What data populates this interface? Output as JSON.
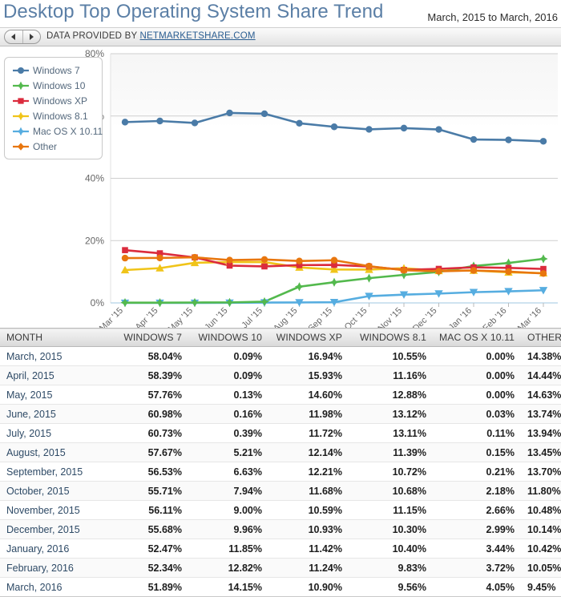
{
  "header": {
    "title": "Desktop Top Operating System Share Trend",
    "date_range": "March, 2015 to March, 2016"
  },
  "toolbar": {
    "prev_label": "◀",
    "next_label": "▶",
    "text_prefix": "DATA PROVIDED BY ",
    "link_label": "NETMARKETSHARE.COM"
  },
  "legend": {
    "items": [
      {
        "label": "Windows 7",
        "color": "#4a7ba7",
        "marker": "circle"
      },
      {
        "label": "Windows 10",
        "color": "#53b94d",
        "marker": "star4"
      },
      {
        "label": "Windows XP",
        "color": "#db2b3d",
        "marker": "square"
      },
      {
        "label": "Windows 8.1",
        "color": "#f0c419",
        "marker": "star5"
      },
      {
        "label": "Mac OS X 10.11",
        "color": "#56ade0",
        "marker": "star6"
      },
      {
        "label": "Other",
        "color": "#e8760e",
        "marker": "diamond"
      }
    ]
  },
  "chart_data": {
    "type": "line",
    "title": "Desktop Top Operating System Share Trend",
    "xlabel": "",
    "ylabel": "",
    "ylim": [
      0,
      80
    ],
    "yticks": [
      "0%",
      "20%",
      "40%",
      "60%",
      "80%"
    ],
    "ytick_values": [
      0,
      20,
      40,
      60,
      80
    ],
    "grid": true,
    "legend_position": "top-left",
    "categories": [
      "Mar '15",
      "Apr '15",
      "May '15",
      "Jun '15",
      "Jul '15",
      "Aug '15",
      "Sep '15",
      "Oct '15",
      "Nov '15",
      "Dec '15",
      "Jan '16",
      "Feb '16",
      "Mar '16"
    ],
    "series": [
      {
        "name": "Windows 7",
        "color": "#4a7ba7",
        "marker": "circle",
        "values": [
          58.04,
          58.39,
          57.76,
          60.98,
          60.73,
          57.67,
          56.53,
          55.71,
          56.11,
          55.68,
          52.47,
          52.34,
          51.89
        ]
      },
      {
        "name": "Windows 10",
        "color": "#53b94d",
        "marker": "star4",
        "values": [
          0.09,
          0.09,
          0.13,
          0.16,
          0.39,
          5.21,
          6.63,
          7.94,
          9.0,
          9.96,
          11.85,
          12.82,
          14.15
        ]
      },
      {
        "name": "Windows XP",
        "color": "#db2b3d",
        "marker": "square",
        "values": [
          16.94,
          15.93,
          14.6,
          11.98,
          11.72,
          12.14,
          12.21,
          11.68,
          10.59,
          10.93,
          11.42,
          11.24,
          10.9
        ]
      },
      {
        "name": "Windows 8.1",
        "color": "#f0c419",
        "marker": "triangle-up",
        "values": [
          10.55,
          11.16,
          12.88,
          13.12,
          13.11,
          11.39,
          10.72,
          10.68,
          11.15,
          10.3,
          10.4,
          9.83,
          9.56
        ]
      },
      {
        "name": "Mac OS X 10.11",
        "color": "#56ade0",
        "marker": "triangle-down",
        "values": [
          0.0,
          0.0,
          0.0,
          0.03,
          0.11,
          0.15,
          0.21,
          2.18,
          2.66,
          2.99,
          3.44,
          3.72,
          4.05
        ]
      },
      {
        "name": "Other",
        "color": "#e8760e",
        "marker": "circle",
        "values": [
          14.38,
          14.44,
          14.63,
          13.74,
          13.94,
          13.45,
          13.7,
          11.8,
          10.48,
          10.14,
          10.42,
          10.05,
          9.45
        ]
      }
    ]
  },
  "table": {
    "columns": [
      "MONTH",
      "WINDOWS 7",
      "WINDOWS 10",
      "WINDOWS XP",
      "WINDOWS 8.1",
      "MAC OS X 10.11",
      "OTHER"
    ],
    "rows": [
      [
        "March, 2015",
        "58.04%",
        "0.09%",
        "16.94%",
        "10.55%",
        "0.00%",
        "14.38%"
      ],
      [
        "April, 2015",
        "58.39%",
        "0.09%",
        "15.93%",
        "11.16%",
        "0.00%",
        "14.44%"
      ],
      [
        "May, 2015",
        "57.76%",
        "0.13%",
        "14.60%",
        "12.88%",
        "0.00%",
        "14.63%"
      ],
      [
        "June, 2015",
        "60.98%",
        "0.16%",
        "11.98%",
        "13.12%",
        "0.03%",
        "13.74%"
      ],
      [
        "July, 2015",
        "60.73%",
        "0.39%",
        "11.72%",
        "13.11%",
        "0.11%",
        "13.94%"
      ],
      [
        "August, 2015",
        "57.67%",
        "5.21%",
        "12.14%",
        "11.39%",
        "0.15%",
        "13.45%"
      ],
      [
        "September, 2015",
        "56.53%",
        "6.63%",
        "12.21%",
        "10.72%",
        "0.21%",
        "13.70%"
      ],
      [
        "October, 2015",
        "55.71%",
        "7.94%",
        "11.68%",
        "10.68%",
        "2.18%",
        "11.80%"
      ],
      [
        "November, 2015",
        "56.11%",
        "9.00%",
        "10.59%",
        "11.15%",
        "2.66%",
        "10.48%"
      ],
      [
        "December, 2015",
        "55.68%",
        "9.96%",
        "10.93%",
        "10.30%",
        "2.99%",
        "10.14%"
      ],
      [
        "January, 2016",
        "52.47%",
        "11.85%",
        "11.42%",
        "10.40%",
        "3.44%",
        "10.42%"
      ],
      [
        "February, 2016",
        "52.34%",
        "12.82%",
        "11.24%",
        "9.83%",
        "3.72%",
        "10.05%"
      ],
      [
        "March, 2016",
        "51.89%",
        "14.15%",
        "10.90%",
        "9.56%",
        "4.05%",
        "9.45%"
      ]
    ]
  }
}
